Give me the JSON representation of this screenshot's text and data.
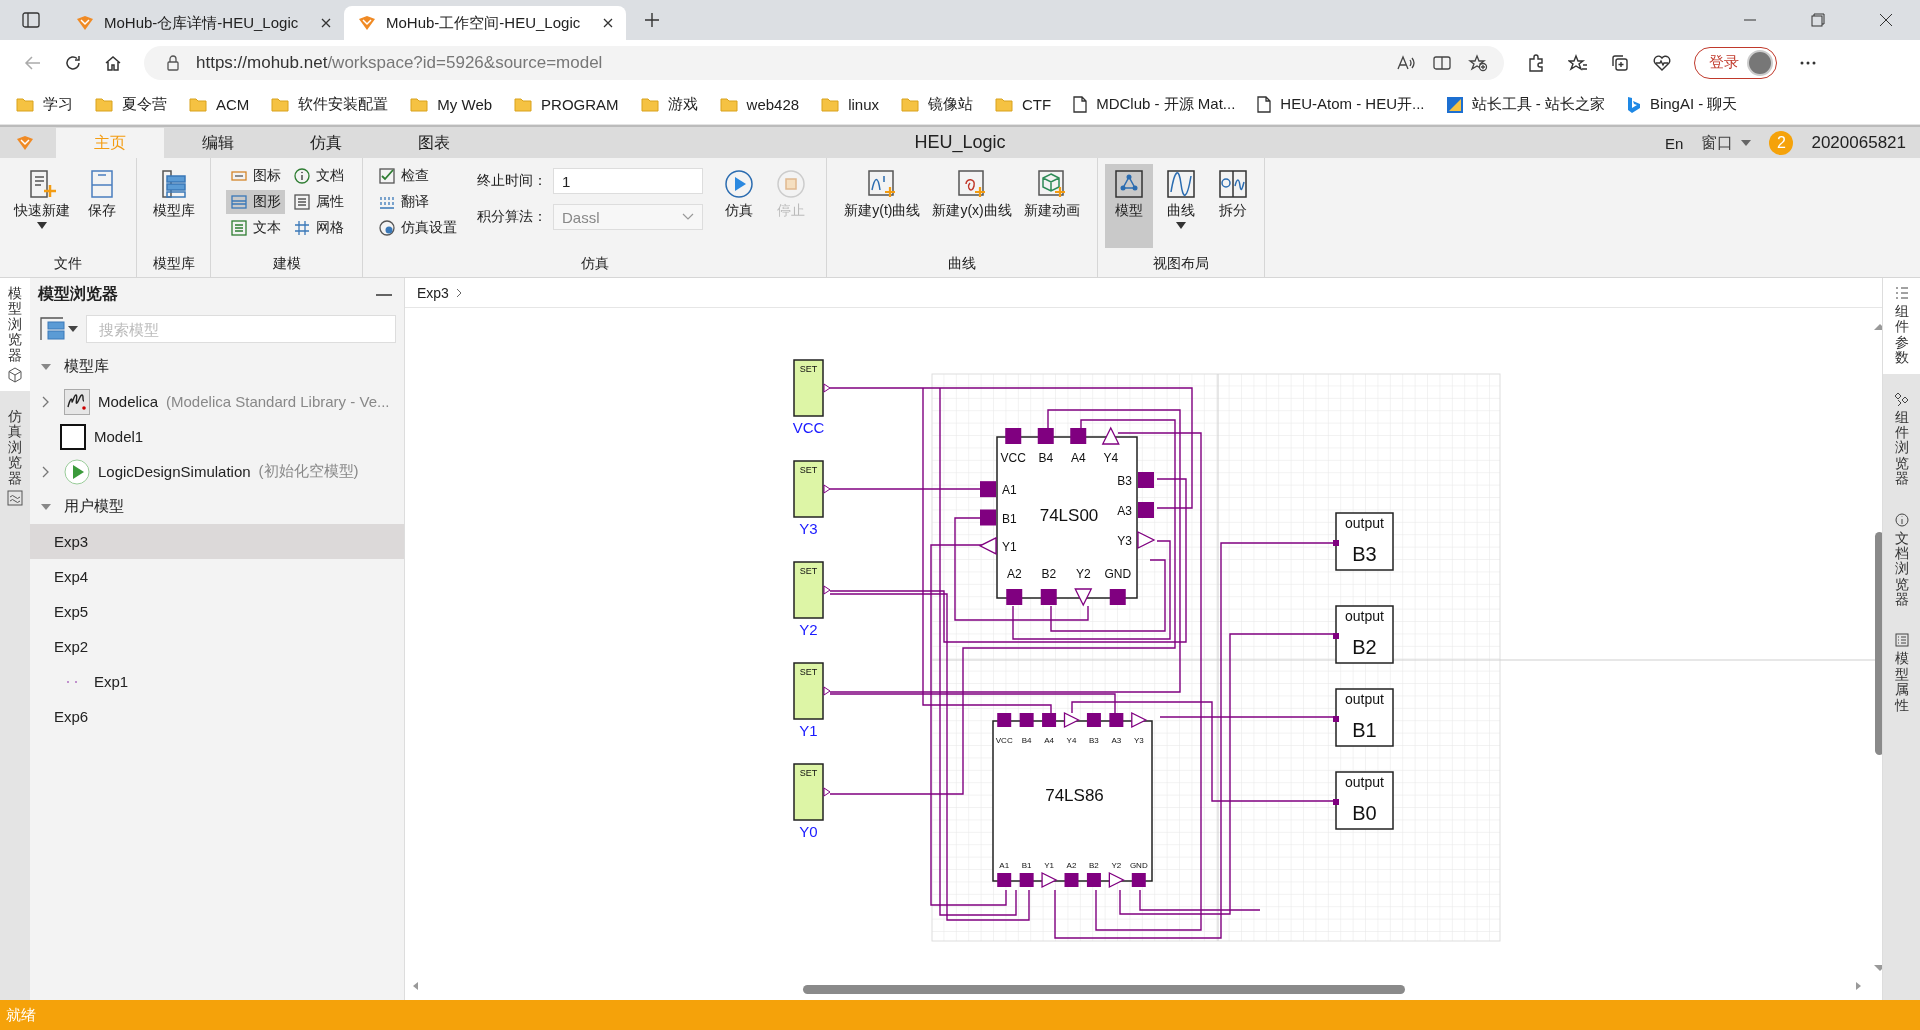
{
  "browser": {
    "tabs": [
      {
        "title": "MoHub-仓库详情-HEU_Logic",
        "selected": false
      },
      {
        "title": "MoHub-工作空间-HEU_Logic",
        "selected": true
      }
    ],
    "url": {
      "host": "https://mohub.net",
      "path": "/workspace?id=5926&source=model"
    },
    "login_label": "登录",
    "bookmarks": [
      {
        "label": "学习",
        "kind": "folder"
      },
      {
        "label": "夏令营",
        "kind": "folder"
      },
      {
        "label": "ACM",
        "kind": "folder"
      },
      {
        "label": "软件安装配置",
        "kind": "folder"
      },
      {
        "label": "My Web",
        "kind": "folder"
      },
      {
        "label": "PROGRAM",
        "kind": "folder"
      },
      {
        "label": "游戏",
        "kind": "folder"
      },
      {
        "label": "web428",
        "kind": "folder"
      },
      {
        "label": "linux",
        "kind": "folder"
      },
      {
        "label": "镜像站",
        "kind": "folder"
      },
      {
        "label": "CTF",
        "kind": "folder"
      },
      {
        "label": "MDClub - 开源 Mat...",
        "kind": "page"
      },
      {
        "label": "HEU-Atom - HEU开...",
        "kind": "page"
      },
      {
        "label": "站长工具 - 站长之家",
        "kind": "site"
      },
      {
        "label": "BingAI - 聊天",
        "kind": "bing"
      }
    ]
  },
  "app": {
    "menu_tabs": [
      {
        "label": "主页",
        "selected": true
      },
      {
        "label": "编辑",
        "selected": false
      },
      {
        "label": "仿真",
        "selected": false
      },
      {
        "label": "图表",
        "selected": false
      }
    ],
    "title": "HEU_Logic",
    "language": "En",
    "window_menu": "窗口",
    "notifications": "2",
    "user": "2020065821"
  },
  "ribbon": {
    "groups": [
      {
        "name": "文件",
        "tools": [
          {
            "kind": "large",
            "label": "快速新建",
            "dropdown": true,
            "selected": false,
            "disabled": false
          },
          {
            "kind": "large",
            "label": "保存",
            "dropdown": false,
            "selected": false,
            "disabled": false
          }
        ]
      },
      {
        "name": "模型库",
        "tools": [
          {
            "kind": "large",
            "label": "模型库",
            "dropdown": false,
            "selected": false,
            "disabled": false
          }
        ]
      },
      {
        "name": "建模",
        "tools": [
          {
            "kind": "small",
            "label": "图标",
            "selected": false,
            "disabled": false
          },
          {
            "kind": "small",
            "label": "图形",
            "selected": true,
            "disabled": false
          },
          {
            "kind": "small",
            "label": "文本",
            "selected": false,
            "disabled": false
          },
          {
            "kind": "small",
            "label": "文档",
            "selected": false,
            "disabled": false
          },
          {
            "kind": "small",
            "label": "属性",
            "selected": false,
            "disabled": false
          },
          {
            "kind": "small",
            "label": "网格",
            "selected": false,
            "disabled": false
          }
        ]
      },
      {
        "name": "仿真",
        "tools": [
          {
            "kind": "small",
            "label": "检查",
            "selected": false,
            "disabled": false
          },
          {
            "kind": "small",
            "label": "翻译",
            "selected": false,
            "disabled": false
          },
          {
            "kind": "small",
            "label": "仿真设置",
            "selected": false,
            "disabled": false
          },
          {
            "kind": "field",
            "label": "终止时间：",
            "value": "1"
          },
          {
            "kind": "select",
            "label": "积分算法：",
            "value": "Dassl"
          },
          {
            "kind": "large",
            "label": "仿真",
            "dropdown": false,
            "selected": false,
            "disabled": false
          },
          {
            "kind": "large",
            "label": "停止",
            "dropdown": false,
            "selected": false,
            "disabled": true
          }
        ]
      },
      {
        "name": "曲线",
        "tools": [
          {
            "kind": "large",
            "label": "新建y(t)曲线",
            "dropdown": false,
            "selected": false,
            "disabled": false
          },
          {
            "kind": "large",
            "label": "新建y(x)曲线",
            "dropdown": false,
            "selected": false,
            "disabled": false
          },
          {
            "kind": "large",
            "label": "新建动画",
            "dropdown": false,
            "selected": false,
            "disabled": false
          }
        ]
      },
      {
        "name": "视图布局",
        "tools": [
          {
            "kind": "large",
            "label": "模型",
            "dropdown": false,
            "selected": true,
            "disabled": false
          },
          {
            "kind": "large",
            "label": "曲线",
            "dropdown": true,
            "selected": false,
            "disabled": false
          },
          {
            "kind": "large",
            "label": "拆分",
            "dropdown": false,
            "selected": false,
            "disabled": false
          }
        ]
      }
    ]
  },
  "left_tabs": [
    {
      "label": "模型浏览器",
      "selected": true
    },
    {
      "label": "仿真浏览器",
      "selected": false
    }
  ],
  "model_browser": {
    "title": "模型浏览器",
    "search": {
      "placeholder": "搜索模型"
    },
    "groups": [
      {
        "label": "模型库",
        "expanded": true,
        "items": [
          {
            "label": "Modelica",
            "note": "(Modelica Standard Library - Ve...",
            "kind": "library",
            "expanded": false,
            "selected": false
          },
          {
            "label": "Model1",
            "kind": "model",
            "selected": false
          },
          {
            "label": "LogicDesignSimulation",
            "note": "(初始化空模型)",
            "kind": "package",
            "expanded": false,
            "selected": false
          }
        ]
      },
      {
        "label": "用户模型",
        "expanded": true,
        "items": [
          {
            "label": "Exp3",
            "kind": "plain",
            "selected": true
          },
          {
            "label": "Exp4",
            "kind": "plain",
            "selected": false
          },
          {
            "label": "Exp5",
            "kind": "plain",
            "selected": false
          },
          {
            "label": "Exp2",
            "kind": "plain",
            "selected": false
          },
          {
            "label": "Exp1",
            "kind": "dotted",
            "selected": false
          },
          {
            "label": "Exp6",
            "kind": "plain",
            "selected": false
          }
        ]
      }
    ]
  },
  "breadcrumb": "Exp3",
  "canvas": {
    "sources": [
      {
        "label": "SET",
        "name": "VCC"
      },
      {
        "label": "SET",
        "name": "Y3"
      },
      {
        "label": "SET",
        "name": "Y2"
      },
      {
        "label": "SET",
        "name": "Y1"
      },
      {
        "label": "SET",
        "name": "Y0"
      }
    ],
    "chips": [
      {
        "name": "74LS00",
        "top_pins": [
          {
            "label": "VCC",
            "kind": "input"
          },
          {
            "label": "B4",
            "kind": "input"
          },
          {
            "label": "A4",
            "kind": "input"
          },
          {
            "label": "Y4",
            "kind": "output"
          }
        ],
        "left_pins": [
          {
            "label": "A1",
            "kind": "input"
          },
          {
            "label": "B1",
            "kind": "input"
          },
          {
            "label": "Y1",
            "kind": "output"
          }
        ],
        "right_pins": [
          {
            "label": "B3",
            "kind": "input"
          },
          {
            "label": "A3",
            "kind": "input"
          },
          {
            "label": "Y3",
            "kind": "output"
          }
        ],
        "bottom_pins": [
          {
            "label": "A2",
            "kind": "input"
          },
          {
            "label": "B2",
            "kind": "input"
          },
          {
            "label": "Y2",
            "kind": "output"
          },
          {
            "label": "GND",
            "kind": "input"
          }
        ]
      },
      {
        "name": "74LS86",
        "top_pins": [
          {
            "label": "VCC",
            "kind": "input"
          },
          {
            "label": "B4",
            "kind": "input"
          },
          {
            "label": "A4",
            "kind": "input"
          },
          {
            "label": "Y4",
            "kind": "output"
          },
          {
            "label": "B3",
            "kind": "input"
          },
          {
            "label": "A3",
            "kind": "input"
          },
          {
            "label": "Y3",
            "kind": "output"
          }
        ],
        "bottom_pins": [
          {
            "label": "A1",
            "kind": "input"
          },
          {
            "label": "B1",
            "kind": "input"
          },
          {
            "label": "Y1",
            "kind": "output"
          },
          {
            "label": "A2",
            "kind": "input"
          },
          {
            "label": "B2",
            "kind": "input"
          },
          {
            "label": "Y2",
            "kind": "output"
          },
          {
            "label": "GND",
            "kind": "input"
          }
        ]
      }
    ],
    "outputs": [
      {
        "label": "output",
        "name": "B3"
      },
      {
        "label": "output",
        "name": "B2"
      },
      {
        "label": "output",
        "name": "B1"
      },
      {
        "label": "output",
        "name": "B0"
      }
    ]
  },
  "right_tabs": [
    {
      "label": "组件参数",
      "selected": true
    },
    {
      "label": "组件浏览器",
      "selected": false
    },
    {
      "label": "文档浏览器",
      "selected": false
    },
    {
      "label": "模型属性",
      "selected": false
    }
  ],
  "status": "就绪"
}
